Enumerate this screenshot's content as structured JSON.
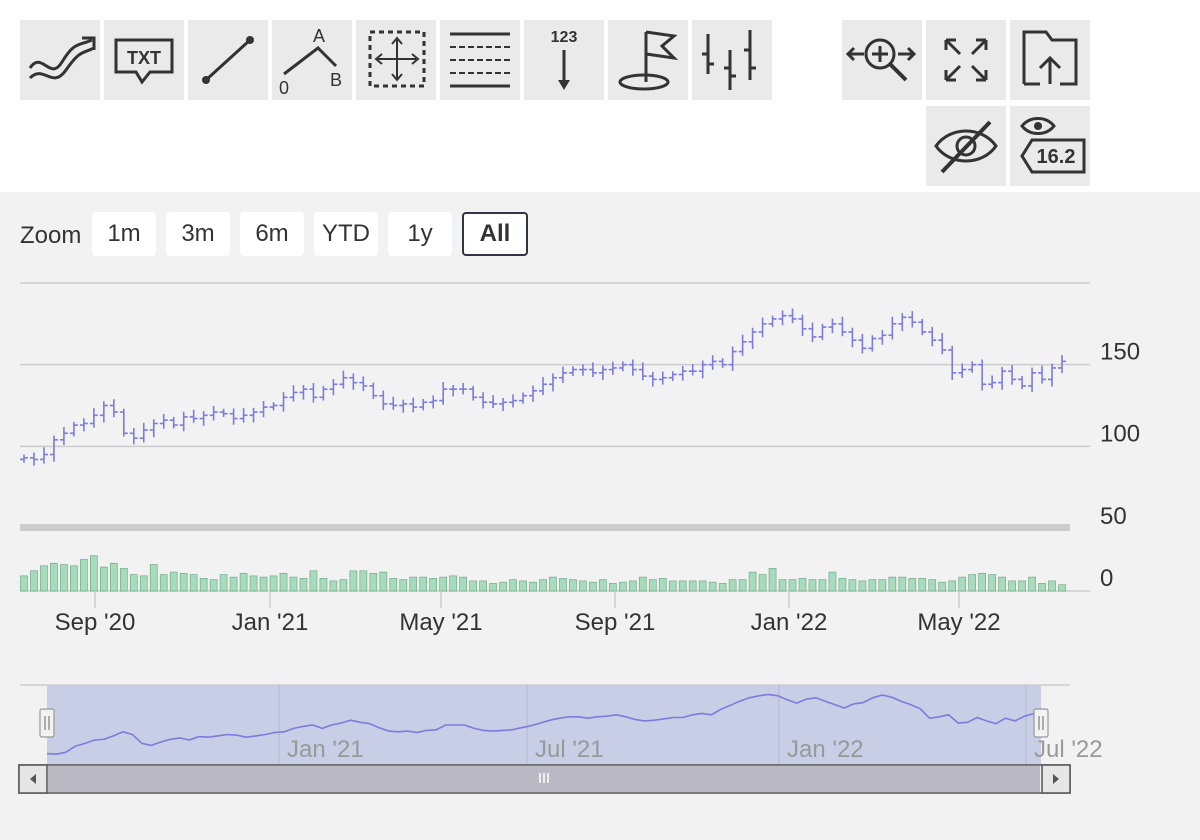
{
  "toolbar": {
    "left_tools": [
      {
        "icon": "indicators-icon"
      },
      {
        "icon": "text-annotation-icon",
        "text": "TXT"
      },
      {
        "icon": "line-segment-icon"
      },
      {
        "icon": "measure-ab-icon",
        "text_a": "A",
        "text_b": "B",
        "text_0": "0"
      },
      {
        "icon": "crosshair-rectangle-icon"
      },
      {
        "icon": "parallel-lines-icon"
      },
      {
        "icon": "vertical-counter-icon",
        "text": "123"
      },
      {
        "icon": "flag-icon"
      },
      {
        "icon": "ohlc-series-icon"
      }
    ],
    "right_tools": [
      {
        "icon": "zoom-change-icon"
      },
      {
        "icon": "fullscreen-icon"
      },
      {
        "icon": "save-chart-icon"
      },
      {
        "icon": "hide-annotations-icon"
      },
      {
        "icon": "current-price-indicator-icon",
        "text": "16.2"
      }
    ]
  },
  "zoom": {
    "label": "Zoom",
    "buttons": [
      "1m",
      "3m",
      "6m",
      "YTD",
      "1y",
      "All"
    ],
    "selected": "All"
  },
  "colors": {
    "ohlc": "#7b7be0",
    "volume_fill": "#a6dcbc",
    "volume_stroke": "#76a98a",
    "navigator_mask": "#c5cbe4",
    "grid": "#cccccc",
    "text": "#333333"
  },
  "chart_data": {
    "type": "ohlc",
    "grid": true,
    "y_axis": {
      "price_ticks": [
        100,
        150
      ],
      "volume_ticks": [
        0,
        50
      ],
      "price_range": [
        50,
        200
      ],
      "volume_range": [
        0,
        50
      ]
    },
    "x_axis": {
      "tick_labels": [
        "Sep '20",
        "Jan '21",
        "May '21",
        "Sep '21",
        "Jan '22",
        "May '22"
      ]
    },
    "price_series": {
      "name": "",
      "closes": [
        93,
        92,
        95,
        104,
        108,
        113,
        114,
        119,
        125,
        121,
        108,
        105,
        110,
        114,
        116,
        113,
        118,
        117,
        119,
        121,
        120,
        117,
        119,
        121,
        124,
        125,
        130,
        133,
        135,
        130,
        135,
        138,
        142,
        139,
        137,
        131,
        126,
        125,
        126,
        124,
        127,
        128,
        135,
        135,
        135,
        130,
        127,
        126,
        127,
        128,
        131,
        134,
        138,
        142,
        145,
        147,
        147,
        145,
        147,
        148,
        150,
        147,
        143,
        141,
        142,
        144,
        146,
        146,
        150,
        152,
        150,
        158,
        164,
        170,
        175,
        178,
        180,
        178,
        172,
        167,
        173,
        175,
        170,
        165,
        160,
        166,
        168,
        175,
        179,
        176,
        170,
        165,
        159,
        145,
        147,
        150,
        138,
        139,
        146,
        141,
        137,
        145,
        141,
        148,
        152
      ]
    },
    "volume_series": {
      "name": "",
      "values": [
        12,
        16,
        20,
        22,
        21,
        20,
        25,
        28,
        19,
        22,
        18,
        13,
        12,
        21,
        13,
        15,
        14,
        13,
        10,
        9,
        13,
        11,
        14,
        12,
        11,
        12,
        14,
        11,
        10,
        16,
        10,
        8,
        9,
        16,
        16,
        14,
        15,
        10,
        9,
        11,
        11,
        10,
        11,
        12,
        11,
        8,
        8,
        6,
        7,
        9,
        8,
        7,
        9,
        11,
        10,
        9,
        8,
        7,
        9,
        6,
        7,
        8,
        11,
        9,
        10,
        8,
        8,
        8,
        8,
        7,
        6,
        9,
        9,
        15,
        13,
        18,
        9,
        9,
        10,
        9,
        9,
        15,
        10,
        9,
        8,
        9,
        9,
        11,
        11,
        10,
        10,
        9,
        7,
        8,
        11,
        13,
        14,
        13,
        11,
        8,
        8,
        11,
        6,
        8,
        5
      ]
    },
    "navigator": {
      "tick_labels": [
        "Jan '21",
        "Jul '21",
        "Jan '22",
        "Jul '22"
      ]
    }
  }
}
